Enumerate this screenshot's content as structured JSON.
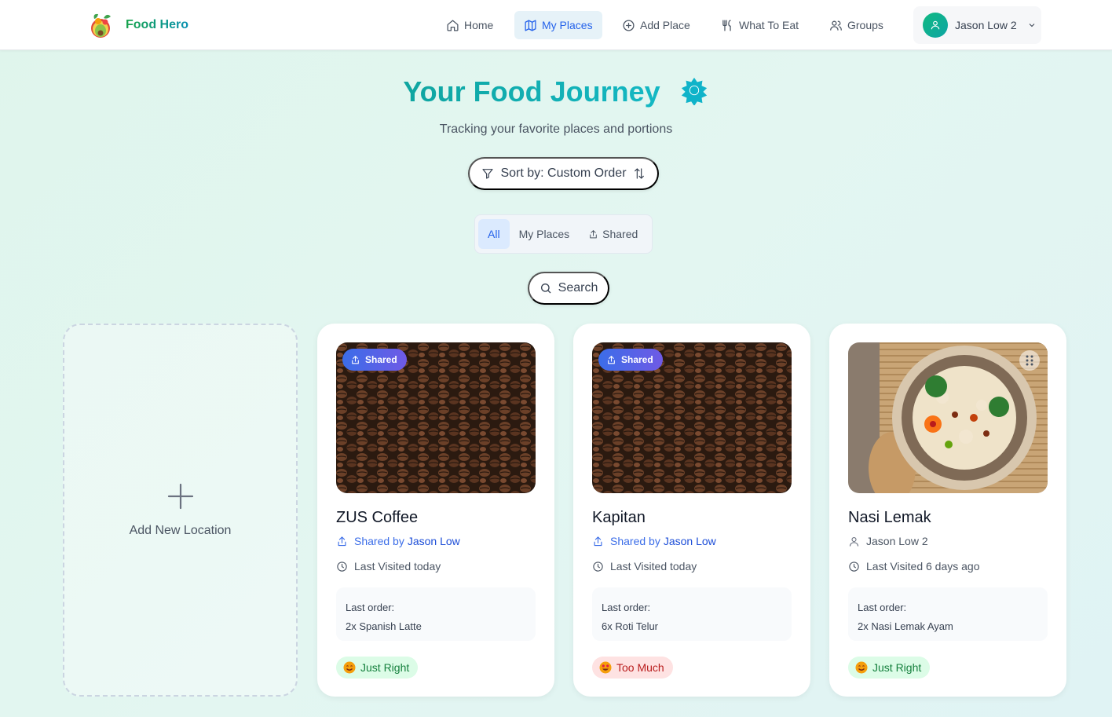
{
  "app": {
    "name": "Food Hero"
  },
  "nav": {
    "items": [
      {
        "label": "Home",
        "icon": "home-icon",
        "active": false
      },
      {
        "label": "My Places",
        "icon": "map-icon",
        "active": true
      },
      {
        "label": "Add Place",
        "icon": "plus-circle-icon",
        "active": false
      },
      {
        "label": "What To Eat",
        "icon": "utensils-icon",
        "active": false
      },
      {
        "label": "Groups",
        "icon": "users-icon",
        "active": false
      }
    ],
    "user": {
      "name": "Jason Low 2"
    }
  },
  "header": {
    "title": "Your Food Journey",
    "subtitle": "Tracking your favorite places and portions"
  },
  "sort": {
    "label": "Sort by: Custom Order"
  },
  "filters": {
    "tabs": [
      {
        "label": "All",
        "active": true
      },
      {
        "label": "My Places",
        "active": false
      },
      {
        "label": "Shared",
        "active": false
      }
    ]
  },
  "search": {
    "label": "Search"
  },
  "add_card": {
    "label": "Add New Location"
  },
  "places": [
    {
      "name": "ZUS Coffee",
      "shared_badge": "Shared",
      "shared_by_prefix": "Shared by",
      "shared_by": "Jason Low",
      "last_visited": "Last Visited today",
      "last_order_label": "Last order:",
      "last_order": "2x Spanish Latte",
      "portion": "Just Right",
      "portion_status": "good"
    },
    {
      "name": "Kapitan",
      "shared_badge": "Shared",
      "shared_by_prefix": "Shared by",
      "shared_by": "Jason Low",
      "last_visited": "Last Visited today",
      "last_order_label": "Last order:",
      "last_order": "6x Roti Telur",
      "portion": "Too Much",
      "portion_status": "much"
    },
    {
      "name": "Nasi Lemak",
      "owner": "Jason Low 2",
      "last_visited": "Last Visited 6 days ago",
      "last_order_label": "Last order:",
      "last_order": "2x Nasi Lemak Ayam",
      "portion": "Just Right",
      "portion_status": "good"
    }
  ],
  "colors": {
    "brand": "#10a37f",
    "accent_blue": "#2563eb",
    "shared_badge": "#4f63e8",
    "title_teal": "#0fa5a0"
  }
}
